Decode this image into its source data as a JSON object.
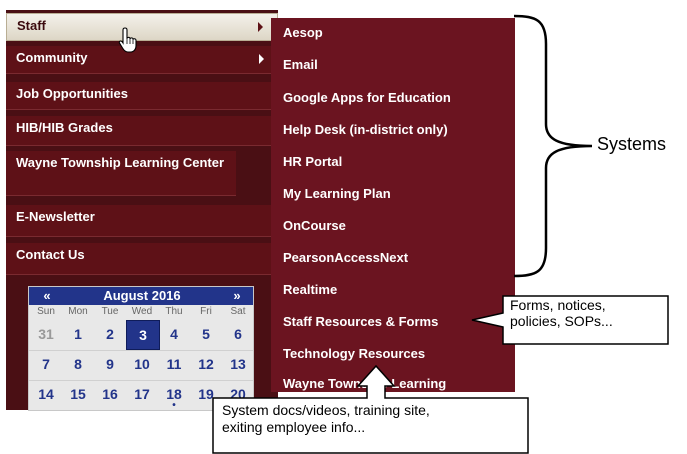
{
  "left_menu": {
    "items": [
      {
        "label": "Staff",
        "arrow": true,
        "active": true
      },
      {
        "label": "Community",
        "arrow": true
      },
      {
        "label": "Job Opportunities"
      },
      {
        "label": "HIB/HIB Grades"
      },
      {
        "label": "Wayne Township Learning Center"
      },
      {
        "label": "E-Newsletter"
      },
      {
        "label": "Contact Us"
      }
    ]
  },
  "calendar": {
    "prev": "«",
    "title": "August 2016",
    "next": "»",
    "weekdays": [
      "Sun",
      "Mon",
      "Tue",
      "Wed",
      "Thu",
      "Fri",
      "Sat"
    ],
    "weeks": [
      [
        "31",
        "1",
        "2",
        "3",
        "4",
        "5",
        "6"
      ],
      [
        "7",
        "8",
        "9",
        "10",
        "11",
        "12",
        "13"
      ],
      [
        "14",
        "15",
        "16",
        "17",
        "18",
        "19",
        "20"
      ]
    ],
    "selected_day": "3",
    "event_day": "18"
  },
  "submenu": {
    "items": [
      "Aesop",
      "Email",
      "Google Apps for Education",
      "Help Desk (in-district only)",
      "HR Portal",
      "My Learning Plan",
      "OnCourse",
      "PearsonAccessNext",
      "Realtime",
      "Staff Resources & Forms",
      "Technology Resources",
      "Wayne Township Learning"
    ]
  },
  "annotations": {
    "systems": "Systems",
    "forms_line1": "Forms, notices,",
    "forms_line2": "policies, SOPs...",
    "sysdocs_line1": "System docs/videos, training site,",
    "sysdocs_line2": "exiting employee info..."
  },
  "colors": {
    "menu_bg": "#5e1117",
    "submenu_bg": "#6b1420",
    "calendar_accent": "#22348a"
  }
}
